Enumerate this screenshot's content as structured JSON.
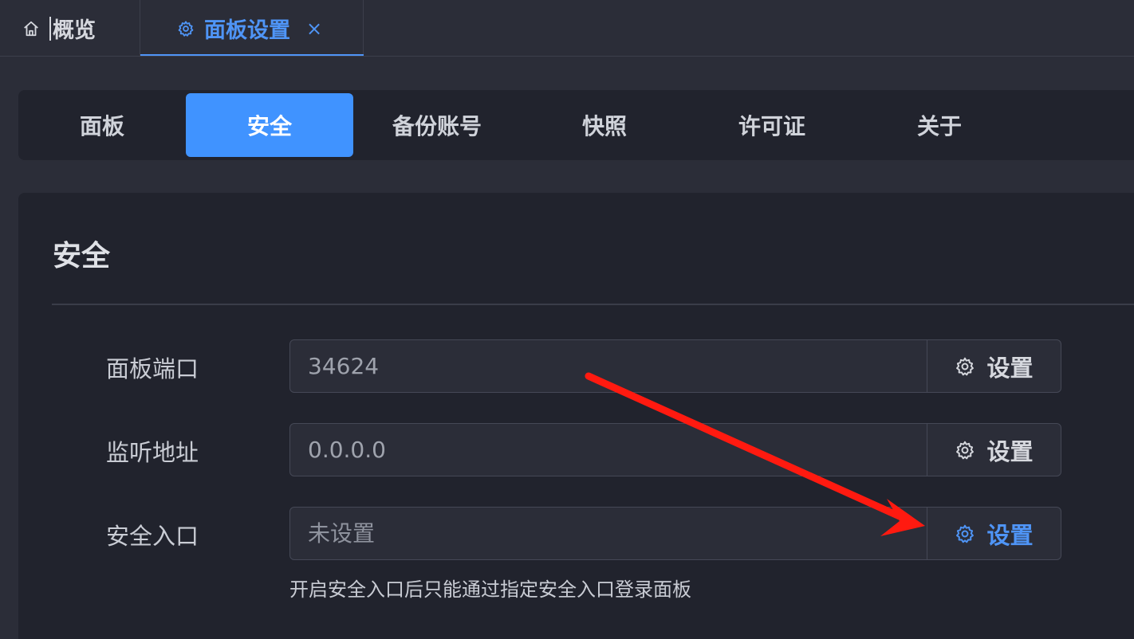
{
  "tabs": {
    "home_label": "概览",
    "settings_label": "面板设置",
    "close_symbol": "×"
  },
  "subnav": {
    "items": [
      "面板",
      "安全",
      "备份账号",
      "快照",
      "许可证",
      "关于"
    ],
    "active": "安全"
  },
  "card": {
    "title": "安全",
    "rows": [
      {
        "label": "面板端口",
        "value": "34624",
        "placeholder": "",
        "button": "设置"
      },
      {
        "label": "监听地址",
        "value": "0.0.0.0",
        "placeholder": "",
        "button": "设置"
      },
      {
        "label": "安全入口",
        "value": "",
        "placeholder": "未设置",
        "button": "设置"
      }
    ],
    "help": "开启安全入口后只能通过指定安全入口登录面板"
  },
  "colors": {
    "accent": "#4093ff",
    "annotation_arrow": "#ff1a10"
  }
}
